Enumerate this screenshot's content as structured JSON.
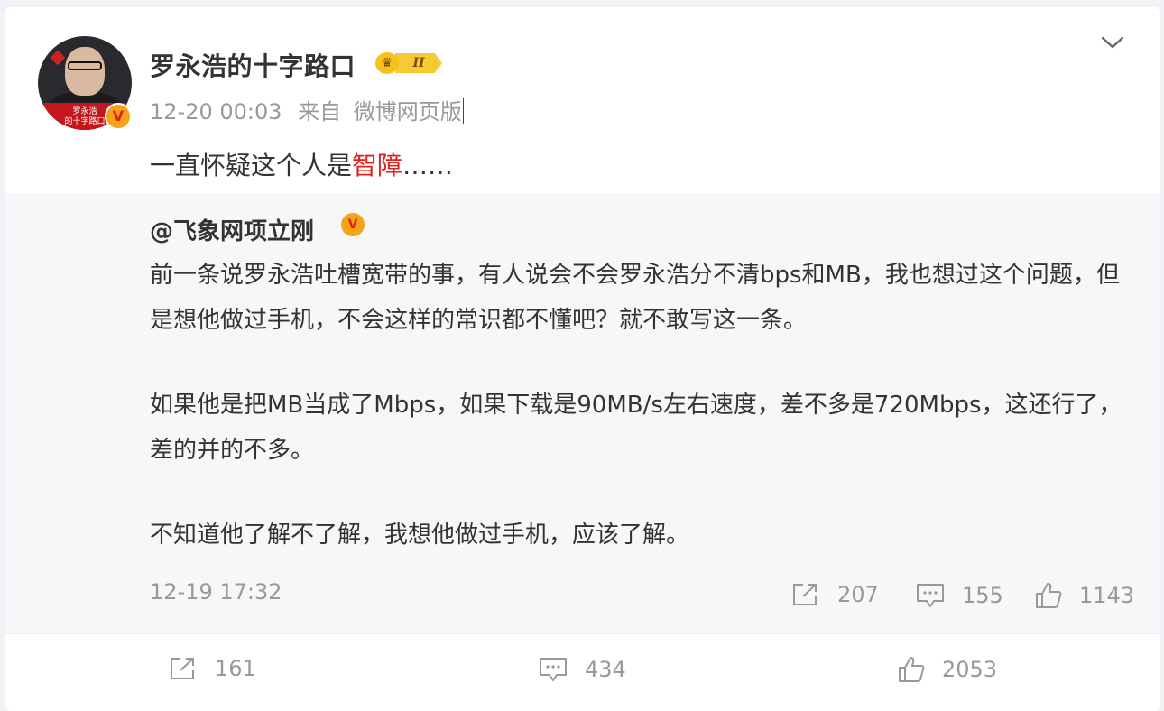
{
  "post": {
    "author": "罗永浩的十字路口",
    "avatar_caption_line1": "罗永浩",
    "avatar_caption_line2": "的十字路口",
    "verified_badge": "V",
    "rank_level": "II",
    "rank_icon": "crown-icon",
    "timestamp": "12-20 00:03",
    "source_prefix": "来自",
    "source": "微博网页版",
    "text_before": "一直怀疑这个人是",
    "text_highlight": "智障",
    "text_after": "……",
    "highlight_color": "#e0201b"
  },
  "repost": {
    "author": "@飞象网项立刚",
    "verified_badge": "V",
    "paragraphs": [
      "前一条说罗永浩吐槽宽带的事，有人说会不会罗永浩分不清bps和MB，我也想过这个问题，但是想他做过手机，不会这样的常识都不懂吧？就不敢写这一条。",
      "如果他是把MB当成了Mbps，如果下载是90MB/s左右速度，差不多是720Mbps，这还行了，差的并的不多。",
      "不知道他了解不了解，我想他做过手机，应该了解。"
    ],
    "date": "12-19 17:32",
    "actions": {
      "share_count": "207",
      "comment_count": "155",
      "like_count": "1143"
    }
  },
  "footer": {
    "share_count": "161",
    "comment_count": "434",
    "like_count": "2053"
  },
  "icons": [
    "chevron-down-icon",
    "share-icon",
    "comment-icon",
    "like-icon"
  ]
}
